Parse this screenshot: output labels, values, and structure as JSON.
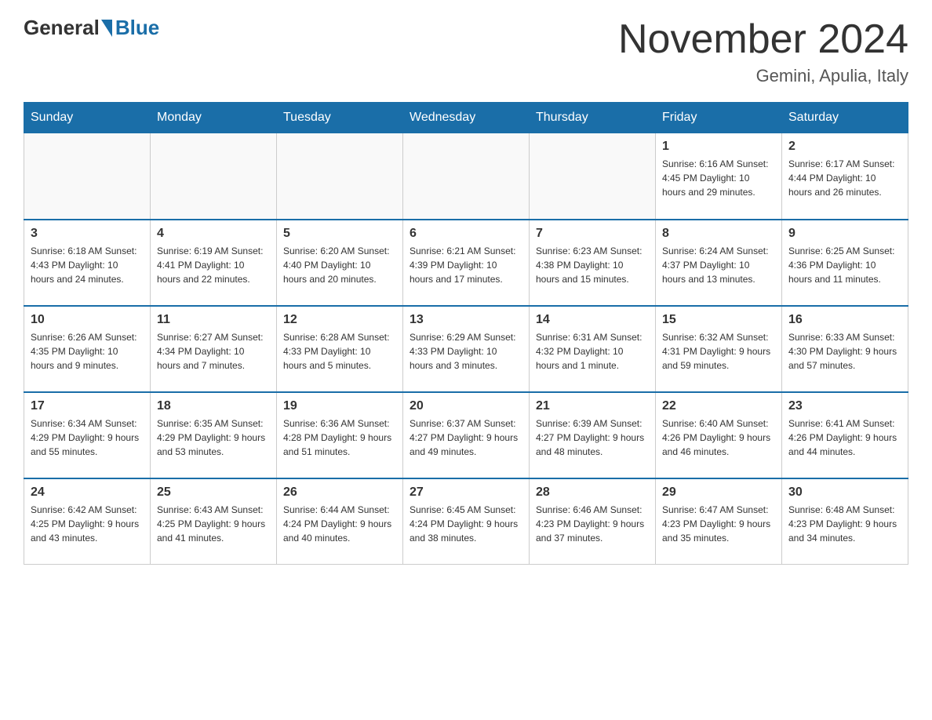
{
  "header": {
    "logo_general": "General",
    "logo_blue": "Blue",
    "title": "November 2024",
    "subtitle": "Gemini, Apulia, Italy"
  },
  "weekdays": [
    "Sunday",
    "Monday",
    "Tuesday",
    "Wednesday",
    "Thursday",
    "Friday",
    "Saturday"
  ],
  "weeks": [
    [
      {
        "day": "",
        "info": ""
      },
      {
        "day": "",
        "info": ""
      },
      {
        "day": "",
        "info": ""
      },
      {
        "day": "",
        "info": ""
      },
      {
        "day": "",
        "info": ""
      },
      {
        "day": "1",
        "info": "Sunrise: 6:16 AM\nSunset: 4:45 PM\nDaylight: 10 hours and 29 minutes."
      },
      {
        "day": "2",
        "info": "Sunrise: 6:17 AM\nSunset: 4:44 PM\nDaylight: 10 hours and 26 minutes."
      }
    ],
    [
      {
        "day": "3",
        "info": "Sunrise: 6:18 AM\nSunset: 4:43 PM\nDaylight: 10 hours and 24 minutes."
      },
      {
        "day": "4",
        "info": "Sunrise: 6:19 AM\nSunset: 4:41 PM\nDaylight: 10 hours and 22 minutes."
      },
      {
        "day": "5",
        "info": "Sunrise: 6:20 AM\nSunset: 4:40 PM\nDaylight: 10 hours and 20 minutes."
      },
      {
        "day": "6",
        "info": "Sunrise: 6:21 AM\nSunset: 4:39 PM\nDaylight: 10 hours and 17 minutes."
      },
      {
        "day": "7",
        "info": "Sunrise: 6:23 AM\nSunset: 4:38 PM\nDaylight: 10 hours and 15 minutes."
      },
      {
        "day": "8",
        "info": "Sunrise: 6:24 AM\nSunset: 4:37 PM\nDaylight: 10 hours and 13 minutes."
      },
      {
        "day": "9",
        "info": "Sunrise: 6:25 AM\nSunset: 4:36 PM\nDaylight: 10 hours and 11 minutes."
      }
    ],
    [
      {
        "day": "10",
        "info": "Sunrise: 6:26 AM\nSunset: 4:35 PM\nDaylight: 10 hours and 9 minutes."
      },
      {
        "day": "11",
        "info": "Sunrise: 6:27 AM\nSunset: 4:34 PM\nDaylight: 10 hours and 7 minutes."
      },
      {
        "day": "12",
        "info": "Sunrise: 6:28 AM\nSunset: 4:33 PM\nDaylight: 10 hours and 5 minutes."
      },
      {
        "day": "13",
        "info": "Sunrise: 6:29 AM\nSunset: 4:33 PM\nDaylight: 10 hours and 3 minutes."
      },
      {
        "day": "14",
        "info": "Sunrise: 6:31 AM\nSunset: 4:32 PM\nDaylight: 10 hours and 1 minute."
      },
      {
        "day": "15",
        "info": "Sunrise: 6:32 AM\nSunset: 4:31 PM\nDaylight: 9 hours and 59 minutes."
      },
      {
        "day": "16",
        "info": "Sunrise: 6:33 AM\nSunset: 4:30 PM\nDaylight: 9 hours and 57 minutes."
      }
    ],
    [
      {
        "day": "17",
        "info": "Sunrise: 6:34 AM\nSunset: 4:29 PM\nDaylight: 9 hours and 55 minutes."
      },
      {
        "day": "18",
        "info": "Sunrise: 6:35 AM\nSunset: 4:29 PM\nDaylight: 9 hours and 53 minutes."
      },
      {
        "day": "19",
        "info": "Sunrise: 6:36 AM\nSunset: 4:28 PM\nDaylight: 9 hours and 51 minutes."
      },
      {
        "day": "20",
        "info": "Sunrise: 6:37 AM\nSunset: 4:27 PM\nDaylight: 9 hours and 49 minutes."
      },
      {
        "day": "21",
        "info": "Sunrise: 6:39 AM\nSunset: 4:27 PM\nDaylight: 9 hours and 48 minutes."
      },
      {
        "day": "22",
        "info": "Sunrise: 6:40 AM\nSunset: 4:26 PM\nDaylight: 9 hours and 46 minutes."
      },
      {
        "day": "23",
        "info": "Sunrise: 6:41 AM\nSunset: 4:26 PM\nDaylight: 9 hours and 44 minutes."
      }
    ],
    [
      {
        "day": "24",
        "info": "Sunrise: 6:42 AM\nSunset: 4:25 PM\nDaylight: 9 hours and 43 minutes."
      },
      {
        "day": "25",
        "info": "Sunrise: 6:43 AM\nSunset: 4:25 PM\nDaylight: 9 hours and 41 minutes."
      },
      {
        "day": "26",
        "info": "Sunrise: 6:44 AM\nSunset: 4:24 PM\nDaylight: 9 hours and 40 minutes."
      },
      {
        "day": "27",
        "info": "Sunrise: 6:45 AM\nSunset: 4:24 PM\nDaylight: 9 hours and 38 minutes."
      },
      {
        "day": "28",
        "info": "Sunrise: 6:46 AM\nSunset: 4:23 PM\nDaylight: 9 hours and 37 minutes."
      },
      {
        "day": "29",
        "info": "Sunrise: 6:47 AM\nSunset: 4:23 PM\nDaylight: 9 hours and 35 minutes."
      },
      {
        "day": "30",
        "info": "Sunrise: 6:48 AM\nSunset: 4:23 PM\nDaylight: 9 hours and 34 minutes."
      }
    ]
  ]
}
